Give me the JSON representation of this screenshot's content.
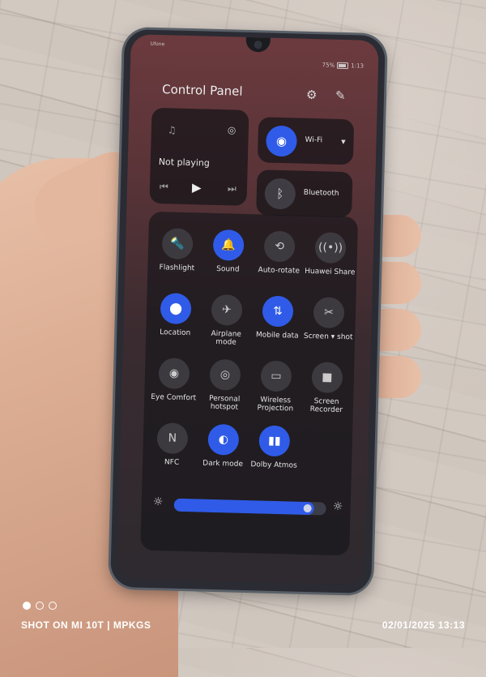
{
  "status_bar": {
    "carrier": "Ufone",
    "battery": "75%",
    "time": "1:13"
  },
  "control_panel": {
    "title": "Control Panel",
    "settings_icon": "gear-icon",
    "edit_icon": "edit-icon",
    "media": {
      "label": "Not playing",
      "icons": [
        "music-note-icon",
        "audio-output-icon",
        "previous-icon",
        "play-icon",
        "next-icon"
      ]
    },
    "wifi": {
      "label": "Wi-Fi",
      "on": true
    },
    "bluetooth": {
      "label": "Bluetooth",
      "on": false
    },
    "toggles": [
      {
        "label": "Flashlight",
        "on": false,
        "icon": "flashlight-icon"
      },
      {
        "label": "Sound",
        "on": true,
        "icon": "bell-icon"
      },
      {
        "label": "Auto-rotate",
        "on": false,
        "icon": "auto-rotate-icon"
      },
      {
        "label": "Huawei Share",
        "on": false,
        "icon": "share-icon"
      },
      {
        "label": "Location",
        "on": true,
        "icon": "location-icon"
      },
      {
        "label": "Airplane mode",
        "on": false,
        "icon": "airplane-icon"
      },
      {
        "label": "Mobile data",
        "on": true,
        "icon": "mobile-data-icon"
      },
      {
        "label": "Screen ▾ shot",
        "on": false,
        "icon": "screenshot-icon"
      },
      {
        "label": "Eye Comfort",
        "on": false,
        "icon": "eye-icon"
      },
      {
        "label": "Personal hotspot",
        "on": false,
        "icon": "hotspot-icon"
      },
      {
        "label": "Wireless Projection",
        "on": false,
        "icon": "projection-icon"
      },
      {
        "label": "Screen Recorder",
        "on": false,
        "icon": "video-camera-icon"
      },
      {
        "label": "NFC",
        "on": false,
        "icon": "nfc-icon"
      },
      {
        "label": "Dark mode",
        "on": true,
        "icon": "dark-mode-icon"
      },
      {
        "label": "Dolby Atmos",
        "on": true,
        "icon": "dolby-icon"
      }
    ],
    "brightness_percent": 92
  },
  "watermark": {
    "left": "SHOT ON MI 10T | MPKGS",
    "right": "02/01/2025  13:13"
  },
  "colors": {
    "accent": "#2f5be8"
  }
}
